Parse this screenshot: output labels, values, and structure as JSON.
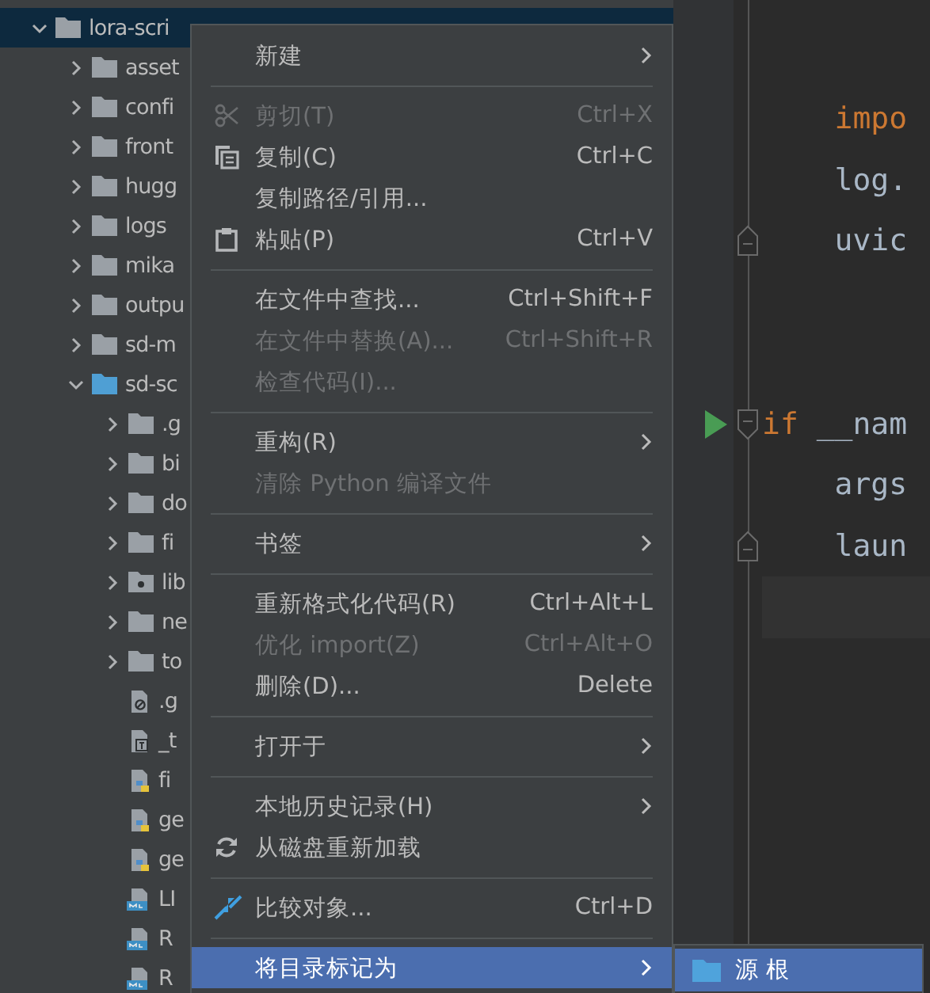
{
  "tree": {
    "name": "lora-scri",
    "kind": "folder",
    "expanded": true,
    "selected": true,
    "children": [
      {
        "name": "asset",
        "kind": "folder",
        "expanded": false,
        "selected": false
      },
      {
        "name": "confi",
        "kind": "folder",
        "expanded": false,
        "selected": false
      },
      {
        "name": "front",
        "kind": "folder",
        "expanded": false,
        "selected": false
      },
      {
        "name": "hugg",
        "kind": "folder",
        "expanded": false,
        "selected": false
      },
      {
        "name": "logs",
        "kind": "folder",
        "expanded": false,
        "selected": false
      },
      {
        "name": "mika",
        "kind": "folder",
        "expanded": false,
        "selected": false
      },
      {
        "name": "outpu",
        "kind": "folder",
        "expanded": false,
        "selected": false
      },
      {
        "name": "sd-m",
        "kind": "folder",
        "expanded": false,
        "selected": false
      },
      {
        "name": "sd-sc",
        "kind": "source_folder",
        "expanded": true,
        "selected": false,
        "children": [
          {
            "name": ".g",
            "kind": "folder",
            "expanded": false,
            "selected": false
          },
          {
            "name": "bi",
            "kind": "folder",
            "expanded": false,
            "selected": false
          },
          {
            "name": "do",
            "kind": "folder",
            "expanded": false,
            "selected": false
          },
          {
            "name": "fi",
            "kind": "folder",
            "expanded": false,
            "selected": false
          },
          {
            "name": "lib",
            "kind": "library_folder",
            "expanded": false,
            "selected": false
          },
          {
            "name": "ne",
            "kind": "folder",
            "expanded": false,
            "selected": false
          },
          {
            "name": "to",
            "kind": "folder",
            "expanded": false,
            "selected": false
          },
          {
            "name": ".g",
            "kind": "ignore_file",
            "selected": false
          },
          {
            "name": "_t",
            "kind": "text_file",
            "selected": false
          },
          {
            "name": "fi",
            "kind": "python_file",
            "selected": false
          },
          {
            "name": "ge",
            "kind": "python_file",
            "selected": false
          },
          {
            "name": "ge",
            "kind": "python_file",
            "selected": false
          },
          {
            "name": "LI",
            "kind": "markdown_file",
            "selected": false
          },
          {
            "name": "R",
            "kind": "markdown_file",
            "selected": false
          },
          {
            "name": "R",
            "kind": "markdown_file",
            "selected": false
          }
        ]
      }
    ]
  },
  "editor": {
    "lines": [
      {
        "kind": "code",
        "tokens": [
          {
            "text": "    impo",
            "kind": "keyword"
          }
        ]
      },
      {
        "kind": "code",
        "tokens": [
          {
            "text": "    log.",
            "kind": "plain"
          }
        ]
      },
      {
        "kind": "code",
        "fold_end": true,
        "tokens": [
          {
            "text": "    uvic",
            "kind": "plain"
          }
        ]
      },
      {
        "kind": "blank"
      },
      {
        "kind": "blank"
      },
      {
        "kind": "code",
        "fold_start": true,
        "run": true,
        "tokens": [
          {
            "text": "if",
            "kind": "keyword"
          },
          {
            "text": " __nam",
            "kind": "plain"
          }
        ]
      },
      {
        "kind": "code",
        "tokens": [
          {
            "text": "    args",
            "kind": "plain"
          }
        ]
      },
      {
        "kind": "code",
        "fold_end": true,
        "tokens": [
          {
            "text": "    laun",
            "kind": "plain"
          }
        ]
      },
      {
        "kind": "blank",
        "current": true
      }
    ]
  },
  "context_menu": {
    "items": [
      {
        "kind": "item",
        "label": "新建",
        "submenu": true,
        "disabled": false,
        "selected": false
      },
      {
        "kind": "separator"
      },
      {
        "kind": "item",
        "label": "剪切(T)",
        "shortcut": "Ctrl+X",
        "disabled": true,
        "selected": false
      },
      {
        "kind": "item",
        "label": "复制(C)",
        "shortcut": "Ctrl+C",
        "disabled": false,
        "selected": false
      },
      {
        "kind": "item",
        "label": "复制路径/引用...",
        "disabled": false,
        "selected": false
      },
      {
        "kind": "item",
        "label": "粘贴(P)",
        "shortcut": "Ctrl+V",
        "disabled": false,
        "selected": false
      },
      {
        "kind": "separator"
      },
      {
        "kind": "item",
        "label": "在文件中查找...",
        "shortcut": "Ctrl+Shift+F",
        "disabled": false,
        "selected": false
      },
      {
        "kind": "item",
        "label": "在文件中替换(A)...",
        "shortcut": "Ctrl+Shift+R",
        "disabled": true,
        "selected": false
      },
      {
        "kind": "item",
        "label": "检查代码(I)...",
        "disabled": true,
        "selected": false
      },
      {
        "kind": "separator"
      },
      {
        "kind": "item",
        "label": "重构(R)",
        "submenu": true,
        "disabled": false,
        "selected": false
      },
      {
        "kind": "item",
        "label": "清除 Python 编译文件",
        "disabled": true,
        "selected": false
      },
      {
        "kind": "separator"
      },
      {
        "kind": "item",
        "label": "书签",
        "submenu": true,
        "disabled": false,
        "selected": false
      },
      {
        "kind": "separator"
      },
      {
        "kind": "item",
        "label": "重新格式化代码(R)",
        "shortcut": "Ctrl+Alt+L",
        "disabled": false,
        "selected": false
      },
      {
        "kind": "item",
        "label": "优化 import(Z)",
        "shortcut": "Ctrl+Alt+O",
        "disabled": true,
        "selected": false
      },
      {
        "kind": "item",
        "label": "删除(D)...",
        "shortcut": "Delete",
        "disabled": false,
        "selected": false
      },
      {
        "kind": "separator"
      },
      {
        "kind": "item",
        "label": "打开于",
        "submenu": true,
        "disabled": false,
        "selected": false
      },
      {
        "kind": "separator"
      },
      {
        "kind": "item",
        "label": "本地历史记录(H)",
        "submenu": true,
        "disabled": false,
        "selected": false
      },
      {
        "kind": "item",
        "label": "从磁盘重新加载",
        "disabled": false,
        "selected": false
      },
      {
        "kind": "separator"
      },
      {
        "kind": "item",
        "label": "比较对象...",
        "shortcut": "Ctrl+D",
        "disabled": false,
        "selected": false
      },
      {
        "kind": "separator"
      },
      {
        "kind": "item",
        "label": "将目录标记为",
        "submenu": true,
        "disabled": false,
        "selected": true
      }
    ]
  },
  "submenu": {
    "items": [
      {
        "label": "源 根",
        "selected": true
      }
    ]
  }
}
